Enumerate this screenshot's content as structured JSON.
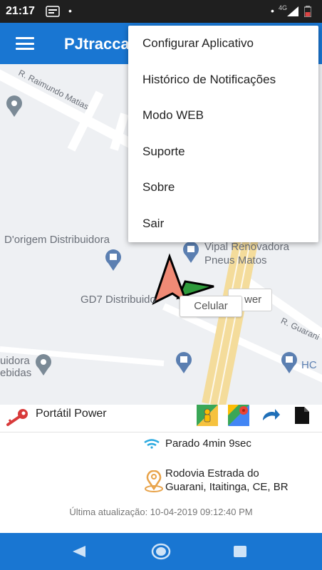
{
  "status_bar": {
    "time": "21:17",
    "network": "4G"
  },
  "app_bar": {
    "title": "PJtracca"
  },
  "menu": {
    "items": [
      "Configurar Aplicativo",
      "Histórico de Notificações",
      "Modo WEB",
      "Suporte",
      "Sobre",
      "Sair"
    ]
  },
  "map": {
    "street_1": "R. Raimundo Matias",
    "street_2": "R. Guarani",
    "poi_1": "D'origem Distribuidora",
    "poi_2a": "Vipal Renovadora",
    "poi_2b": "Pneus Matos",
    "poi_3": "GD7 Distribuido",
    "poi_4a": "uidora",
    "poi_4b": "ebidas",
    "poi_5": "HC",
    "poi_6": "wer",
    "callout": "Celular"
  },
  "info": {
    "device_name": "Portátil Power",
    "status": "Parado 4min 9sec",
    "address_line1": "Rodovia Estrada do",
    "address_line2": "Guarani, Itaitinga, CE, BR",
    "updated": "Última atualização: 10-04-2019 09:12:40 PM"
  }
}
